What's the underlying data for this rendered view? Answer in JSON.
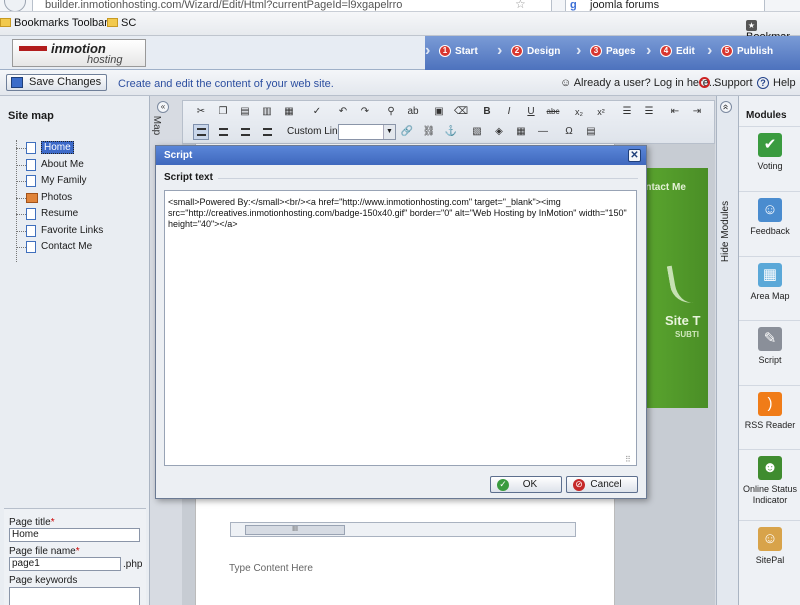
{
  "browser": {
    "url": "builder.inmotionhosting.com/Wizard/Edit/Html?currentPageId=l9xgapelrro",
    "search_value": "joomla forums",
    "bookmarks": [
      "Bookmarks Toolbar",
      "SC",
      "Bookmar"
    ]
  },
  "header": {
    "logo_name": "inmotion",
    "logo_sub": "hosting",
    "steps": [
      {
        "num": "1",
        "label": "Start"
      },
      {
        "num": "2",
        "label": "Design"
      },
      {
        "num": "3",
        "label": "Pages"
      },
      {
        "num": "4",
        "label": "Edit"
      },
      {
        "num": "5",
        "label": "Publish"
      }
    ]
  },
  "actionbar": {
    "save_label": "Save Changes",
    "tip": "Create and edit the content of your web site.",
    "login": "Already a user? Log in here...",
    "support": "Support",
    "help": "Help"
  },
  "sitemap": {
    "title": "Site map",
    "items": [
      "Home",
      "About Me",
      "My Family",
      "Photos",
      "Resume",
      "Favorite Links",
      "Contact Me"
    ],
    "selected": "Home"
  },
  "properties": {
    "page_title_label": "Page title",
    "page_title_value": "Home",
    "file_name_label": "Page file name",
    "file_name_value": "page1",
    "file_ext": ".php",
    "keywords_label": "Page keywords"
  },
  "editor": {
    "map_tab": "Map",
    "custom_links": "Custom Links",
    "contact_text": "Contact Me",
    "site_title": "Site T",
    "site_sub": "SUBTI",
    "type_content": "Type Content Here",
    "scroll_grip": "III"
  },
  "modules": {
    "hide_label": "Hide Modules",
    "title": "Modules",
    "items": [
      {
        "label": "Voting",
        "icon": "voting-icon",
        "color": "#3a9b3f",
        "glyph": "✔"
      },
      {
        "label": "Feedback",
        "icon": "feedback-icon",
        "color": "#4a8ccf",
        "glyph": "☺"
      },
      {
        "label": "Area Map",
        "icon": "area-map-icon",
        "color": "#5aa8d8",
        "glyph": "▦"
      },
      {
        "label": "Script",
        "icon": "script-icon",
        "color": "#8a8f99",
        "glyph": "✎"
      },
      {
        "label": "RSS Reader",
        "icon": "rss-icon",
        "color": "#f07c18",
        "glyph": ")"
      },
      {
        "label": "Online Status Indicator",
        "icon": "status-icon",
        "color": "#3f8c2f",
        "glyph": "☻"
      },
      {
        "label": "SitePal",
        "icon": "sitepal-icon",
        "color": "#d8a34a",
        "glyph": "☺"
      }
    ]
  },
  "dialog": {
    "title": "Script",
    "section_label": "Script text",
    "script_text": "<small>Powered By:</small><br/><a href=\"http://www.inmotionhosting.com\" target=\"_blank\"><img src=\"http://creatives.inmotionhosting.com/badge-150x40.gif\" border=\"0\" alt=\"Web Hosting by InMotion\" width=\"150\" height=\"40\"></a>",
    "ok_label": "OK",
    "cancel_label": "Cancel"
  },
  "colors": {
    "accent": "#3f68bd",
    "step_bar": "#4d72bd",
    "green_banner": "#5da930"
  }
}
